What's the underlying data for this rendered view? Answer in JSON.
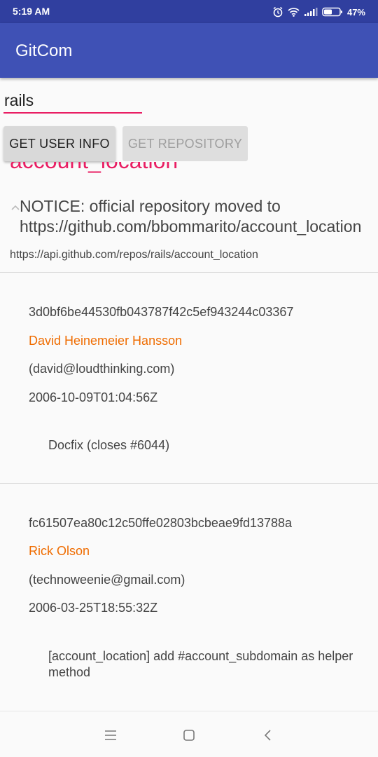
{
  "status_bar": {
    "time": "5:19 AM",
    "battery": "47%",
    "icons": [
      "alarm-icon",
      "wifi-icon",
      "signal-icon",
      "battery-icon"
    ]
  },
  "app_bar": {
    "title": "GitCom",
    "color": "#3f51b5"
  },
  "search": {
    "value": "rails"
  },
  "buttons": {
    "get_user_info": "GET USER INFO",
    "get_repository": "GET REPOSITORY"
  },
  "repo": {
    "name": "account_location",
    "description": "NOTICE: official repository moved to https://github.com/bbommarito/account_location",
    "url": "https://api.github.com/repos/rails/account_location"
  },
  "commits": [
    {
      "sha": "3d0bf6be44530fb043787f42c5ef943244c03367",
      "author": "David Heinemeier Hansson",
      "email": "(david@loudthinking.com)",
      "date": "2006-10-09T01:04:56Z",
      "message": "Docfix (closes #6044)"
    },
    {
      "sha": "fc61507ea80c12c50ffe02803bcbeae9fd13788a",
      "author": "Rick Olson",
      "email": "(technoweenie@gmail.com)",
      "date": "2006-03-25T18:55:32Z",
      "message": "[account_location] add #account_subdomain as helper method"
    }
  ],
  "colors": {
    "accent": "#e91e63",
    "author": "#ef6c00",
    "status_bar": "#303f9f"
  },
  "nav": [
    "menu-icon",
    "home-icon",
    "back-icon"
  ]
}
